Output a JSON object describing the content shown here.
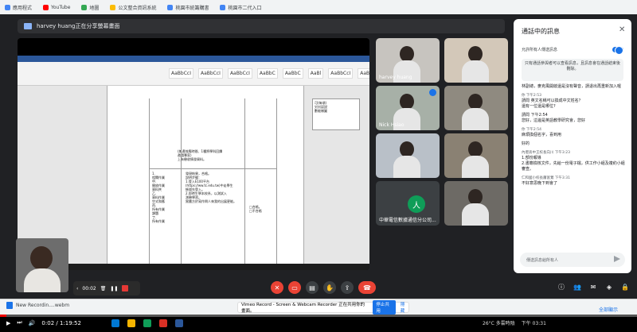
{
  "bookmarks": [
    {
      "label": "應用程式",
      "color": "#4285f4"
    },
    {
      "label": "YouTube",
      "color": "#ff0000"
    },
    {
      "label": "地圖",
      "color": "#34a853"
    },
    {
      "label": "公文整合資訊系統",
      "color": "#fbbc04"
    },
    {
      "label": "桃園市統籌購書",
      "color": "#4285f4"
    },
    {
      "label": "桃園市二代入口",
      "color": "#4285f4"
    }
  ],
  "meet": {
    "presenting_banner": "harvey huang正在分享螢幕畫面"
  },
  "shared_screen": {
    "ribbon_styles": [
      "AaBbCcI",
      "AaBbCcI",
      "AaBbCcI",
      "AaBbC",
      "AaBbC",
      "AaBl",
      "AaBbCcI",
      "AaBb",
      "AaBb"
    ],
    "doc_paragraph_1": "(無遺效應時間、1種將學科回饋\n邀請專家)\n上有驗收情發資料。",
    "doc_paragraph_2": "發現結果，合格。\n說明步驟：\n1.登入E100平台\n(https://ww.tc.edu.tw)中走學生\n帳號先登入。\n2.即時生學本校系，以測試入\n測驗學習。\n實畫方於寫作問人來我的出展更能。",
    "doc_left_col": "1.\n相關作業\n甲.\n開放作業\n資料夾\n乙.\n資料作業\n空式和應\n丙.\n所有作業\n課題\n丁.\n所有作業",
    "doc_right_col": "□合格。\n□不合格",
    "side_notes": "可(每項)\n另另認說\n數能樣圖"
  },
  "participants": [
    {
      "name": "harvey huang",
      "bg": "#c7c4bf"
    },
    {
      "name": "",
      "bg": "#d3c8b9"
    },
    {
      "name": "Nick Hsiao",
      "bg": "#a7b0a7"
    },
    {
      "name": "",
      "bg": "#8f8a80"
    },
    {
      "name": "",
      "bg": "#b9c0c8"
    },
    {
      "name": "",
      "bg": "#8a8173"
    },
    {
      "name": "中華電信數據通信分公司...",
      "bg": "#3c4043",
      "avatar": "人"
    },
    {
      "name": "",
      "bg": "#6d6a65"
    }
  ],
  "chat": {
    "title": "通話中的訊息",
    "allow_label": "允許所有人傳送訊息",
    "notice": "只有通話參與者可以查看訊息，且訊息會在通話結束後刪除。",
    "messages": [
      {
        "who": "",
        "text": "林副總，麥克風開啟還是沒有聲音，請退出再重新加入喔"
      },
      {
        "who": "你  下午2:53",
        "text": "請問 英文名稱可以換成中文姓名？\n還有一位還是哪位?"
      },
      {
        "who": "",
        "text": "請問  下午2:54\n您好，這邊是英語教學研究會，您好"
      },
      {
        "who": "你  下午2:54",
        "text": "麻煩換個名字，喜到用"
      },
      {
        "who": "",
        "text": "好的"
      },
      {
        "who": "內壢高中王校長向川  下午3:23",
        "text": "1.部份報導\n2.書籍檢核文件，先給一份電子檔，供工作小組及複約小組審查。"
      },
      {
        "who": "仁和國小校長蕭富鶯  下午3:31",
        "text": "不好意思晚下到會了"
      }
    ],
    "input_placeholder": "傳送訊息給所有人"
  },
  "recording": {
    "time": "00:02"
  },
  "download": {
    "file": "New Recordin....webm",
    "banner_text": "Vimeo Record - Screen & Webcam Recorder 正在共用你的畫面。",
    "stop_label": "停止共用",
    "hide_label": "隱藏",
    "show_all": "全部顯示"
  },
  "player": {
    "time": "0:02 / 1:19:52",
    "progress": 0.01
  },
  "tray": {
    "weather": "26°C 多雲時陰",
    "clock": "下午 03:31"
  }
}
